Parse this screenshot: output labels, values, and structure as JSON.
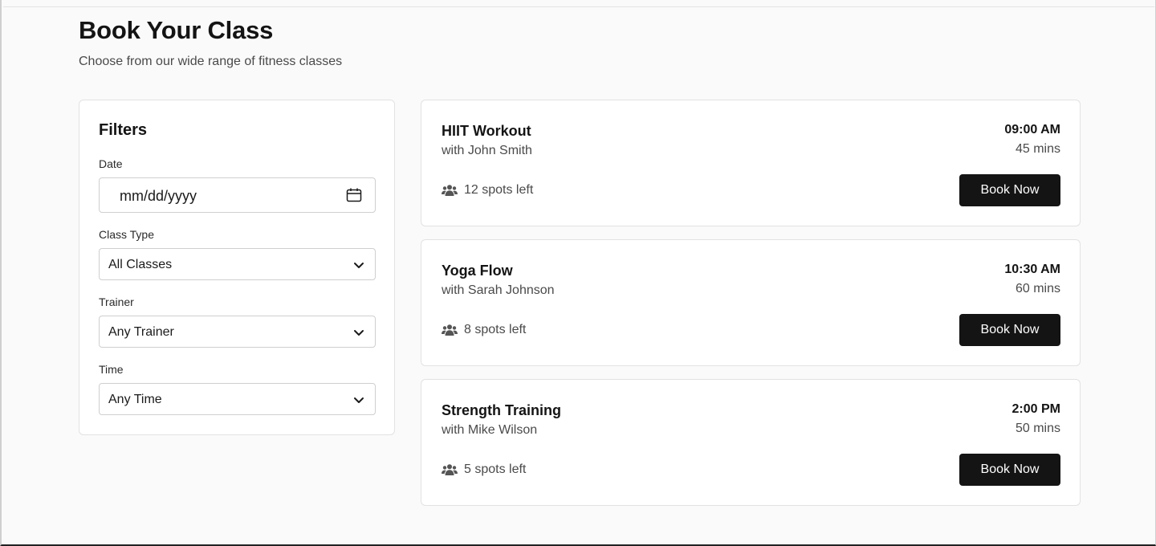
{
  "page": {
    "title": "Book Your Class",
    "subtitle": "Choose from our wide range of fitness classes"
  },
  "filters": {
    "title": "Filters",
    "date": {
      "label": "Date",
      "placeholder": "mm/dd/yyyy",
      "icon": "calendar-icon"
    },
    "class_type": {
      "label": "Class Type",
      "selected": "All Classes",
      "icon": "chevron-down-icon"
    },
    "trainer": {
      "label": "Trainer",
      "selected": "Any Trainer",
      "icon": "chevron-down-icon"
    },
    "time": {
      "label": "Time",
      "selected": "Any Time",
      "icon": "chevron-down-icon"
    }
  },
  "classes": [
    {
      "name": "HIIT Workout",
      "trainer": "with John Smith",
      "time": "09:00 AM",
      "duration": "45 mins",
      "spots": "12 spots left",
      "button": "Book Now",
      "icon": "users-icon"
    },
    {
      "name": "Yoga Flow",
      "trainer": "with Sarah Johnson",
      "time": "10:30 AM",
      "duration": "60 mins",
      "spots": "8 spots left",
      "button": "Book Now",
      "icon": "users-icon"
    },
    {
      "name": "Strength Training",
      "trainer": "with Mike Wilson",
      "time": "2:00 PM",
      "duration": "50 mins",
      "spots": "5 spots left",
      "button": "Book Now",
      "icon": "users-icon"
    }
  ],
  "colors": {
    "background": "#fafafa",
    "card": "#ffffff",
    "primary_button": "#141414",
    "text_primary": "#141414",
    "text_secondary": "#4a4a4a",
    "border": "#e2e2e2"
  }
}
